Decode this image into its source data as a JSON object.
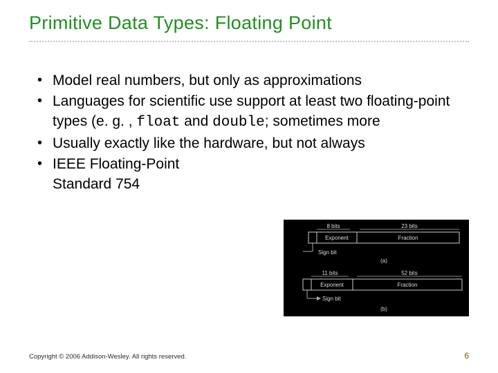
{
  "title": "Primitive Data Types: Floating Point",
  "bullets": {
    "b1": "Model real numbers, but only as approximations",
    "b2a": "Languages for scientific use support at least two floating-point types (e. g. , ",
    "b2_float": "float",
    "b2b": " and ",
    "b2_double": "double",
    "b2c": "; sometimes more",
    "b3": "Usually exactly like the hardware, but not always",
    "b4a": "IEEE Floating-Point",
    "b4b": "Standard 754"
  },
  "diagram": {
    "top_bits_left": "8 bits",
    "top_bits_right": "23 bits",
    "top_exp": "Exponent",
    "top_frac": "Fraction",
    "top_sign": "Sign bit",
    "top_caption": "(a)",
    "bot_bits_left": "11 bits",
    "bot_bits_right": "52 bits",
    "bot_exp": "Exponent",
    "bot_frac": "Fraction",
    "bot_sign": "Sign bit",
    "bot_caption": "(b)"
  },
  "footer": {
    "copyright": "Copyright © 2006 Addison-Wesley. All rights reserved.",
    "page": "6"
  }
}
